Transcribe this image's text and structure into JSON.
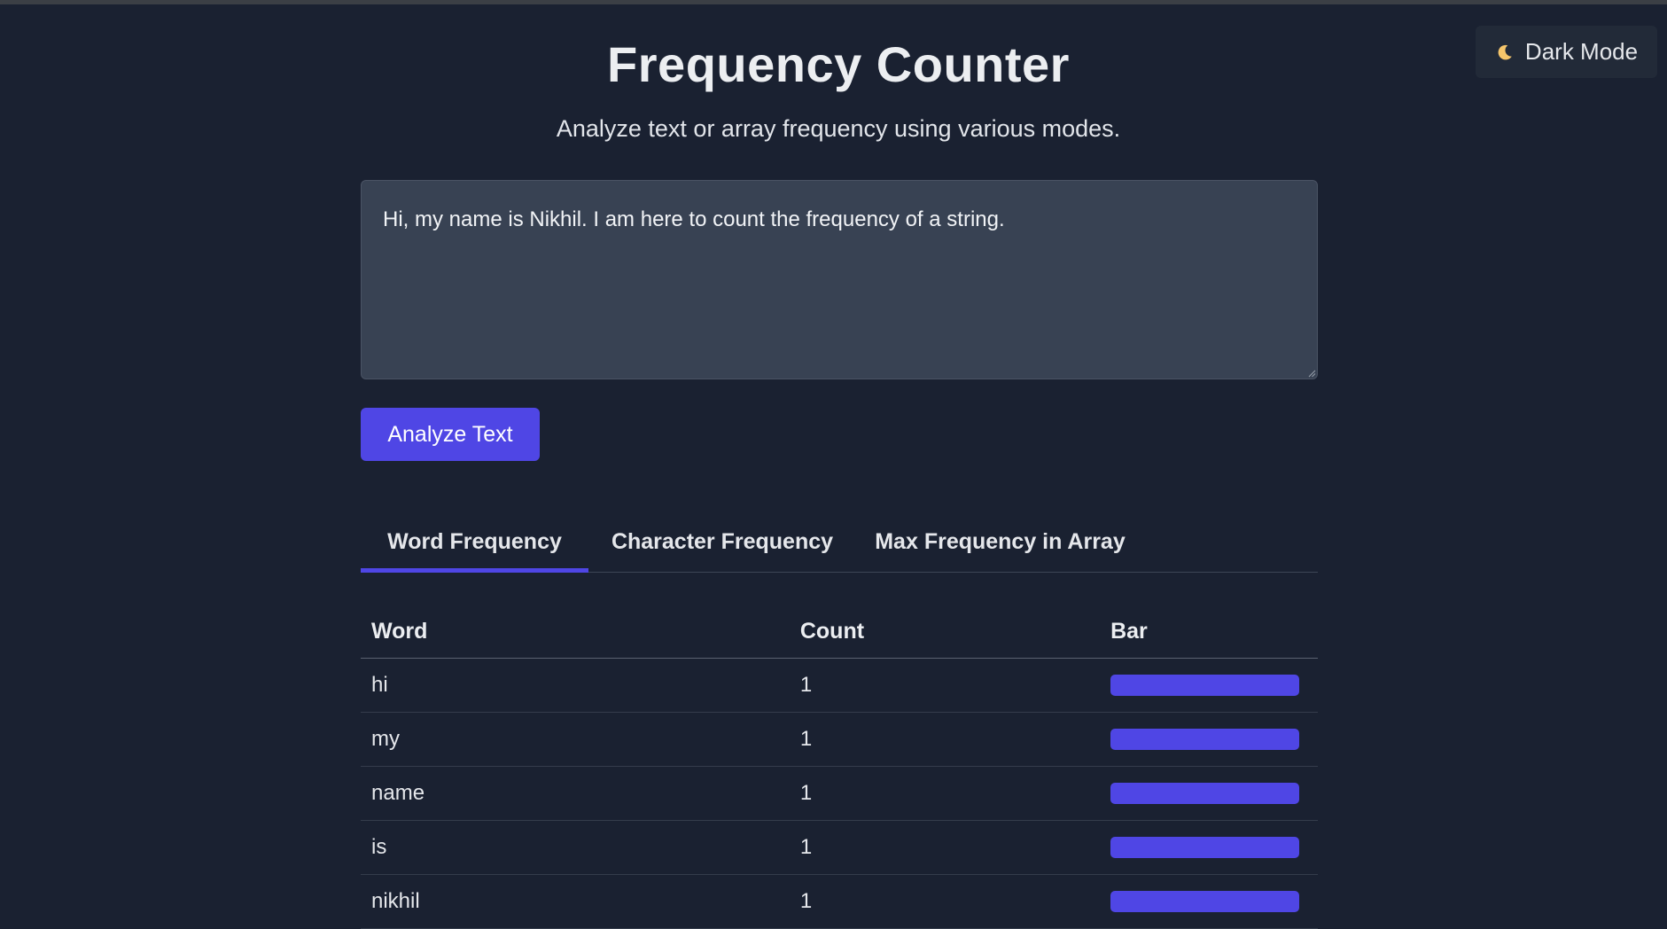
{
  "header": {
    "title": "Frequency Counter",
    "subtitle": "Analyze text or array frequency using various modes."
  },
  "theme_toggle": {
    "icon": "moon-icon",
    "label": "Dark Mode"
  },
  "input": {
    "value": "Hi, my name is Nikhil. I am here to count the frequency of a string."
  },
  "analyze_button": {
    "label": "Analyze Text"
  },
  "tabs": [
    {
      "label": "Word Frequency",
      "active": true
    },
    {
      "label": "Character Frequency",
      "active": false
    },
    {
      "label": "Max Frequency in Array",
      "active": false
    }
  ],
  "table": {
    "headers": [
      "Word",
      "Count",
      "Bar"
    ],
    "rows": [
      {
        "word": "hi",
        "count": "1",
        "bar_fraction": 1.0
      },
      {
        "word": "my",
        "count": "1",
        "bar_fraction": 1.0
      },
      {
        "word": "name",
        "count": "1",
        "bar_fraction": 1.0
      },
      {
        "word": "is",
        "count": "1",
        "bar_fraction": 1.0
      },
      {
        "word": "nikhil",
        "count": "1",
        "bar_fraction": 1.0
      }
    ]
  },
  "colors": {
    "background": "#1a2131",
    "accent": "#4f46e5",
    "input_background": "#384253",
    "moon": "#f5c56b"
  }
}
